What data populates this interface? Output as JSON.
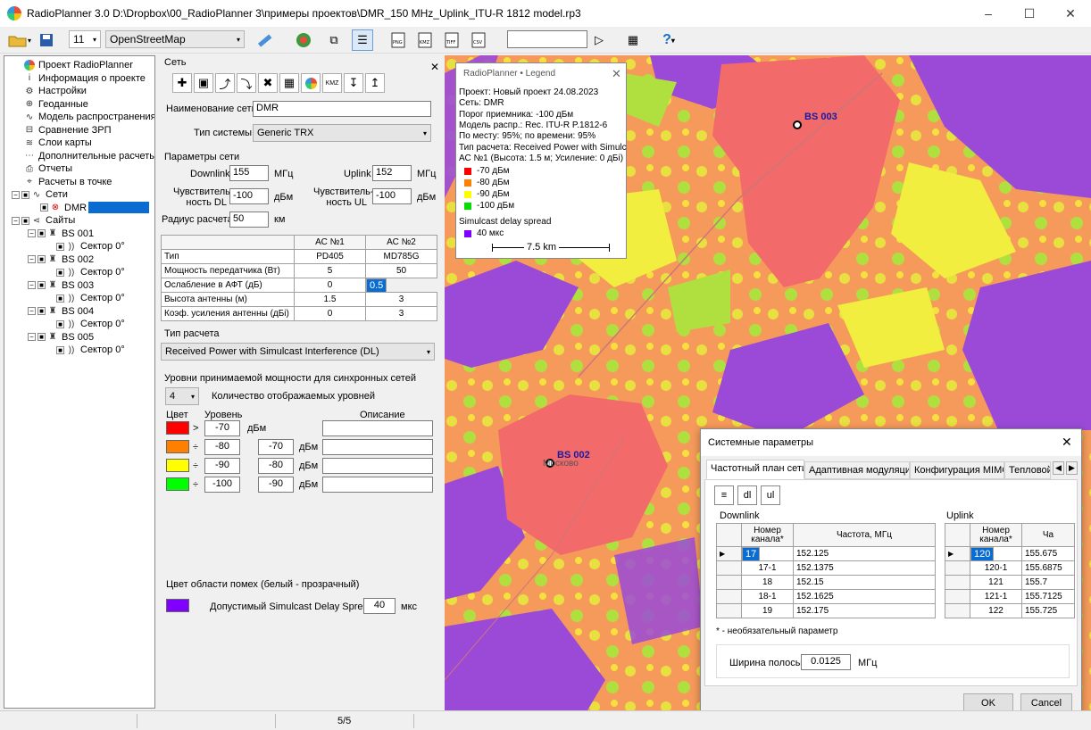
{
  "window": {
    "title": "RadioPlanner 3.0 D:\\Dropbox\\00_RadioPlanner 3\\примеры проектов\\DMR_150 MHz_Uplink_ITU-R 1812 model.rp3"
  },
  "toolbar": {
    "zoom": "11",
    "map_source": "OpenStreetMap",
    "help": "?"
  },
  "tree": {
    "items": [
      {
        "label": "Проект RadioPlanner",
        "icon": "globe-icon"
      },
      {
        "label": "Информация о проекте",
        "icon": "info-icon"
      },
      {
        "label": "Настройки",
        "icon": "gear-icon"
      },
      {
        "label": "Геоданные",
        "icon": "globe-grid-icon"
      },
      {
        "label": "Модель распространения",
        "icon": "wave-icon"
      },
      {
        "label": "Сравнение ЗРП",
        "icon": "compare-icon"
      },
      {
        "label": "Слои карты",
        "icon": "layers-icon"
      },
      {
        "label": "Дополнительные расчеты",
        "icon": "calc-icon"
      },
      {
        "label": "Отчеты",
        "icon": "printer-icon"
      },
      {
        "label": "Расчеты в точке",
        "icon": "point-icon"
      }
    ],
    "networks_label": "Сети",
    "network_dmr": "DMR",
    "sites_label": "Сайты",
    "sites": [
      {
        "name": "BS 001",
        "sector": "Сектор 0°"
      },
      {
        "name": "BS 002",
        "sector": "Сектор 0°"
      },
      {
        "name": "BS 003",
        "sector": "Сектор 0°"
      },
      {
        "name": "BS 004",
        "sector": "Сектор 0°"
      },
      {
        "name": "BS 005",
        "sector": "Сектор 0°"
      }
    ]
  },
  "panel": {
    "section_net": "Сеть",
    "close": "✕",
    "net_name_label": "Наименование сети",
    "net_name": "DMR",
    "system_type_label": "Тип системы",
    "system_type": "Generic TRX",
    "params_title": "Параметры сети",
    "downlink_label": "Downlink",
    "downlink": "155",
    "uplink_label": "Uplink",
    "uplink": "152",
    "mhz": "МГц",
    "sens_dl_label1": "Чувствитель-",
    "sens_dl_label2": "ность DL",
    "sens_dl": "-100",
    "sens_ul_label1": "Чувствитель-",
    "sens_ul_label2": "ность UL",
    "sens_ul": "-100",
    "dbm": "дБм",
    "radius_label": "Радиус расчета",
    "radius": "50",
    "km": "км",
    "table": {
      "headers": [
        "",
        "АС №1",
        "АС №2"
      ],
      "rows": [
        [
          "Тип",
          "PD405",
          "MD785G"
        ],
        [
          "Мощность передатчика (Вт)",
          "5",
          "50"
        ],
        [
          "Ослабление в АФТ (дБ)",
          "0",
          "0.5"
        ],
        [
          "Высота антенны (м)",
          "1.5",
          "3"
        ],
        [
          "Коэф. усиления антенны (дБі)",
          "0",
          "3"
        ]
      ]
    },
    "calc_type_title": "Тип расчета",
    "calc_type": "Received Power with Simulcast Interference (DL)",
    "levels_title": "Уровни принимаемой мощности для синхронных сетей",
    "levels_count": "4",
    "levels_count_label": "Количество отображаемых уровней",
    "col_color": "Цвет",
    "col_level": "Уровень",
    "col_desc": "Описание",
    "levels": [
      {
        "color": "#ff0000",
        "op": ">",
        "v1": "-70",
        "v2": "",
        "unit": "дБм"
      },
      {
        "color": "#ff8000",
        "op": "÷",
        "v1": "-80",
        "v2": "-70",
        "unit": "дБм"
      },
      {
        "color": "#ffff00",
        "op": "÷",
        "v1": "-90",
        "v2": "-80",
        "unit": "дБм"
      },
      {
        "color": "#00ff00",
        "op": "÷",
        "v1": "-100",
        "v2": "-90",
        "unit": "дБм"
      }
    ],
    "interf_title": "Цвет области помех (белый - прозрачный)",
    "interf_color": "#8000ff",
    "delay_label": "Допустимый Simulcast Delay Spread",
    "delay": "40",
    "delay_unit": "мкс"
  },
  "legend": {
    "title": "RadioPlanner • Legend",
    "lines": [
      "Проект: Новый проект 24.08.2023",
      "Сеть: DMR",
      "Порог приемника: -100 дБм",
      "Модель распр.: Rec. ITU-R P.1812-6",
      "По месту: 95%; по времени: 95%",
      "Тип расчета: Received Power with Simulc",
      "АС №1 (Высота: 1.5 м; Усиление: 0 дБі)"
    ],
    "items": [
      {
        "color": "#ff0000",
        "label": "-70 дБм"
      },
      {
        "color": "#ff8000",
        "label": "-80 дБм"
      },
      {
        "color": "#ffff00",
        "label": "-90 дБм"
      },
      {
        "color": "#00e000",
        "label": "-100 дБм"
      }
    ],
    "simulcast_label": "Simulcast delay spread",
    "simulcast_item": {
      "color": "#8000ff",
      "label": "40 мкс"
    },
    "scale": "7.5 km"
  },
  "map": {
    "markers": [
      {
        "label": "BS 003"
      },
      {
        "label": "BS 002"
      }
    ],
    "town": "Москово"
  },
  "dialog": {
    "title": "Системные параметры",
    "tabs": [
      "Частотный план сети",
      "Адаптивная модуляция",
      "Конфигурация MIMO",
      "Тепловой"
    ],
    "downlink_title": "Downlink",
    "uplink_title": "Uplink",
    "dl_headers": [
      "Номер канала*",
      "Частота, МГц"
    ],
    "dl_rows": [
      [
        "17",
        "152.125"
      ],
      [
        "17-1",
        "152.1375"
      ],
      [
        "18",
        "152.15"
      ],
      [
        "18-1",
        "152.1625"
      ],
      [
        "19",
        "152.175"
      ]
    ],
    "ul_headers": [
      "Номер канала*",
      "Ча"
    ],
    "ul_rows": [
      [
        "120",
        "155.675"
      ],
      [
        "120-1",
        "155.6875"
      ],
      [
        "121",
        "155.7"
      ],
      [
        "121-1",
        "155.7125"
      ],
      [
        "122",
        "155.725"
      ]
    ],
    "note": "* - необязательный параметр",
    "bw_label": "Ширина полосы",
    "bw": "0.0125",
    "bw_unit": "МГц",
    "ok": "OK",
    "cancel": "Cancel",
    "dl_btn": "dl",
    "ul_btn": "ul"
  },
  "status": {
    "page": "5/5"
  }
}
